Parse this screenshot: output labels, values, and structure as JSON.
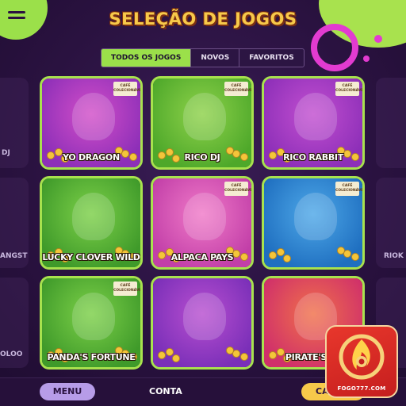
{
  "header": {
    "title": "SELEÇÃO DE JOGOS"
  },
  "tabs": [
    {
      "label": "TODOS OS JOGOS",
      "active": true
    },
    {
      "label": "NOVOS",
      "active": false
    },
    {
      "label": "FAVORITOS",
      "active": false
    }
  ],
  "games": [
    {
      "name": "YO DRAGON",
      "bg": "#8d2fb8",
      "bg2": "#d24ec8",
      "badge": "CAFÉ COLECIONÁVEL"
    },
    {
      "name": "RICO DJ",
      "bg": "#4ea82a",
      "bg2": "#8ed24a",
      "badge": "CAFÉ COLECIONÁVEL"
    },
    {
      "name": "RICO RABBIT",
      "bg": "#8d2fb8",
      "bg2": "#c24fd0",
      "badge": "CAFÉ COLECIONÁVEL"
    },
    {
      "name": "LUCKY CLOVER WILD",
      "bg": "#3f9a2a",
      "bg2": "#7cd048",
      "badge": ""
    },
    {
      "name": "ALPACA PAYS",
      "bg": "#c23fa8",
      "bg2": "#f07ac8",
      "badge": "CAFÉ COLECIONÁVEL"
    },
    {
      "name": "",
      "bg": "#1f6fc0",
      "bg2": "#4ea8e8",
      "badge": "CAFÉ COLECIONÁVEL"
    },
    {
      "name": "PANDA'S FORTUNE",
      "bg": "#3f9a2a",
      "bg2": "#7cd048",
      "badge": "CAFÉ COLECIONÁVEL"
    },
    {
      "name": "",
      "bg": "#7a2fb8",
      "bg2": "#b84fd0",
      "badge": ""
    },
    {
      "name": "PIRATE'S PL",
      "bg": "#d0306a",
      "bg2": "#f0704a",
      "badge": ""
    }
  ],
  "ghosts": {
    "left": [
      "DJ",
      "ANGST",
      "OLOO"
    ],
    "right": [
      "",
      "RIOK",
      ""
    ]
  },
  "bottom": {
    "menu_label": "MENU",
    "account_label": "CONTA",
    "cart_label": "CA"
  },
  "logo": {
    "text": "FOGO777.COM"
  },
  "colors": {
    "accent_green": "#9be04a",
    "accent_magenta": "#e23bd0",
    "title_gold": "#f7c94a",
    "background": "#2a1240"
  },
  "icons": [
    "menu-icon",
    "flame-logo-icon"
  ]
}
